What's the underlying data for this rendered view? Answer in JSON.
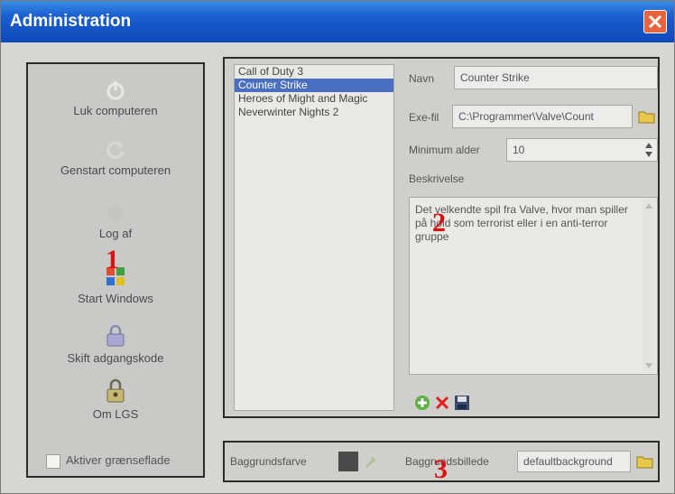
{
  "window": {
    "title": "Administration"
  },
  "sidebar": {
    "items": [
      {
        "label": "Luk computeren",
        "icon": "power-icon"
      },
      {
        "label": "Genstart computeren",
        "icon": "restart-icon"
      },
      {
        "label": "Log af",
        "icon": "logoff-icon"
      },
      {
        "label": "Start Windows",
        "icon": "windows-icon"
      },
      {
        "label": "Skift adgangskode",
        "icon": "padlock-icon"
      },
      {
        "label": "Om LGS",
        "icon": "about-icon"
      }
    ],
    "checkbox_label": "Aktiver grænseflade"
  },
  "markers": {
    "one": "1",
    "two": "2",
    "three": "3"
  },
  "games": {
    "items": [
      "Call of Duty 3",
      "Counter Strike",
      "Heroes of Might and Magic",
      "Neverwinter Nights 2"
    ],
    "selected_index": 1
  },
  "detail": {
    "name_label": "Navn",
    "name_value": "Counter Strike",
    "exe_label": "Exe-fil",
    "exe_value": "C:\\Programmer\\Valve\\Count",
    "min_age_label": "Minimum alder",
    "min_age_value": "10",
    "desc_label": "Beskrivelse",
    "desc_value": "Det velkendte spil fra Valve, hvor man spiller på hold som terrorist eller i en anti-terror gruppe"
  },
  "actions": [
    "add-icon",
    "delete-icon",
    "save-icon"
  ],
  "bottom": {
    "bg_color_label": "Baggrundsfarve",
    "bg_color_value": "#4a4a4a",
    "bg_image_label": "Baggrundsbillede",
    "bg_image_value": "defaultbackground"
  }
}
